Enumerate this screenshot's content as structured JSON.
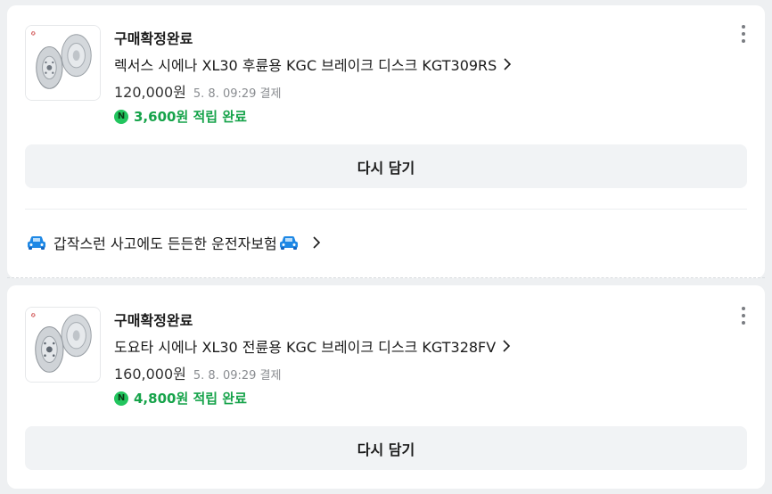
{
  "orders": [
    {
      "status": "구매확정완료",
      "title": "렉서스 시에나 XL30 후륜용 KGC 브레이크 디스크 KGT309RS",
      "price": "120,000원",
      "paid_at": "5. 8. 09:29 결제",
      "reward": "3,600원 적립 완료",
      "action_label": "다시 담기"
    },
    {
      "status": "구매확정완료",
      "title": "도요타 시에나 XL30 전륜용 KGC 브레이크 디스크 KGT328FV",
      "price": "160,000원",
      "paid_at": "5. 8. 09:29 결제",
      "reward": "4,800원 적립 완료",
      "action_label": "다시 담기"
    }
  ],
  "promo": {
    "text": "갑작스런 사고에도 든든한 운전자보험",
    "icons": [
      "car-icon",
      "car-icon"
    ]
  },
  "icons": {
    "more": "more-vertical-icon",
    "chevron": "chevron-right-icon",
    "reward": "npay-point-icon"
  },
  "colors": {
    "reward_green": "#16a34a",
    "button_bg": "#f1f3f5",
    "car_blue": "#1e88e5"
  }
}
